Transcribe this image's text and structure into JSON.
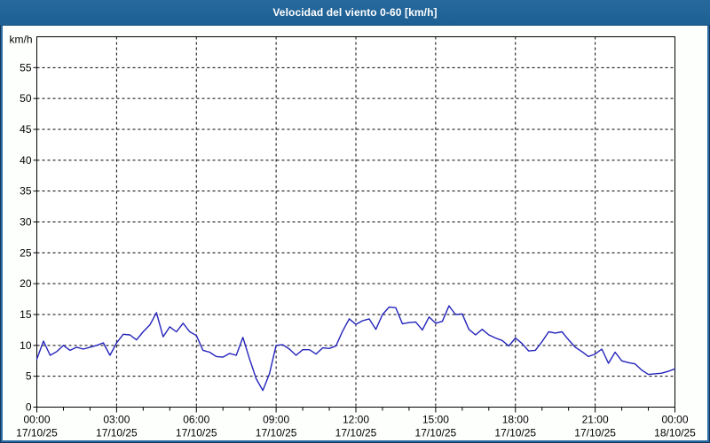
{
  "window": {
    "title": "Velocidad del viento 0-60 [km/h]"
  },
  "colors": {
    "titlebar_bg": "#1F6396",
    "titlebar_text": "#FFFFFF",
    "frame_outer": "#12375B",
    "frame_inner": "#2E6DA4",
    "content_bg": "#FDFFFD",
    "plot_bg": "#FFFFFF",
    "axis": "#000000",
    "grid": "#000000",
    "tick_text": "#000000",
    "line": "#2323BB"
  },
  "chart_data": {
    "type": "line",
    "title": "Velocidad del viento 0-60 [km/h]",
    "ylabel": "km/h",
    "xlabel": "",
    "ylim": [
      0,
      60
    ],
    "ytick_step": 5,
    "ytick_labels": [
      "0",
      "5",
      "10",
      "15",
      "20",
      "25",
      "30",
      "35",
      "40",
      "45",
      "50",
      "55"
    ],
    "xticks": [
      {
        "time": "00:00",
        "date": "17/10/25"
      },
      {
        "time": "03:00",
        "date": "17/10/25"
      },
      {
        "time": "06:00",
        "date": "17/10/25"
      },
      {
        "time": "09:00",
        "date": "17/10/25"
      },
      {
        "time": "12:00",
        "date": "17/10/25"
      },
      {
        "time": "15:00",
        "date": "17/10/25"
      },
      {
        "time": "18:00",
        "date": "17/10/25"
      },
      {
        "time": "21:00",
        "date": "17/10/25"
      },
      {
        "time": "00:00",
        "date": "18/10/25"
      }
    ],
    "minor_xtick_interval_hours": 1,
    "x_span_hours": 24,
    "grid": "dashed",
    "legend_position": "none",
    "series": [
      {
        "name": "Velocidad del viento",
        "unit": "km/h",
        "start_time": "17/10/25 00:00",
        "end_time": "18/10/25 00:00",
        "sample_interval_minutes": 15,
        "values": [
          7.8,
          10.7,
          8.4,
          9.0,
          10.0,
          9.2,
          9.7,
          9.4,
          9.7,
          10.0,
          10.4,
          8.4,
          10.4,
          11.8,
          11.7,
          10.9,
          12.2,
          13.3,
          15.3,
          11.4,
          13.0,
          12.2,
          13.6,
          12.2,
          11.6,
          9.2,
          8.9,
          8.2,
          8.1,
          8.7,
          8.4,
          11.3,
          7.8,
          4.6,
          2.7,
          5.4,
          10.0,
          10.1,
          9.4,
          8.4,
          9.3,
          9.3,
          8.6,
          9.6,
          9.5,
          9.9,
          12.3,
          14.3,
          13.4,
          14.0,
          14.3,
          12.6,
          15.0,
          16.2,
          16.1,
          13.5,
          13.7,
          13.8,
          12.5,
          14.6,
          13.6,
          13.9,
          16.4,
          15.0,
          15.1,
          12.6,
          11.7,
          12.6,
          11.7,
          11.2,
          10.8,
          9.9,
          11.2,
          10.3,
          9.1,
          9.2,
          10.6,
          12.2,
          12.0,
          12.2,
          10.9,
          9.7,
          9.0,
          8.2,
          8.6,
          9.4,
          7.1,
          8.9,
          7.5,
          7.2,
          7.0,
          6.0,
          5.3,
          5.4,
          5.5,
          5.8,
          6.2
        ]
      }
    ]
  }
}
